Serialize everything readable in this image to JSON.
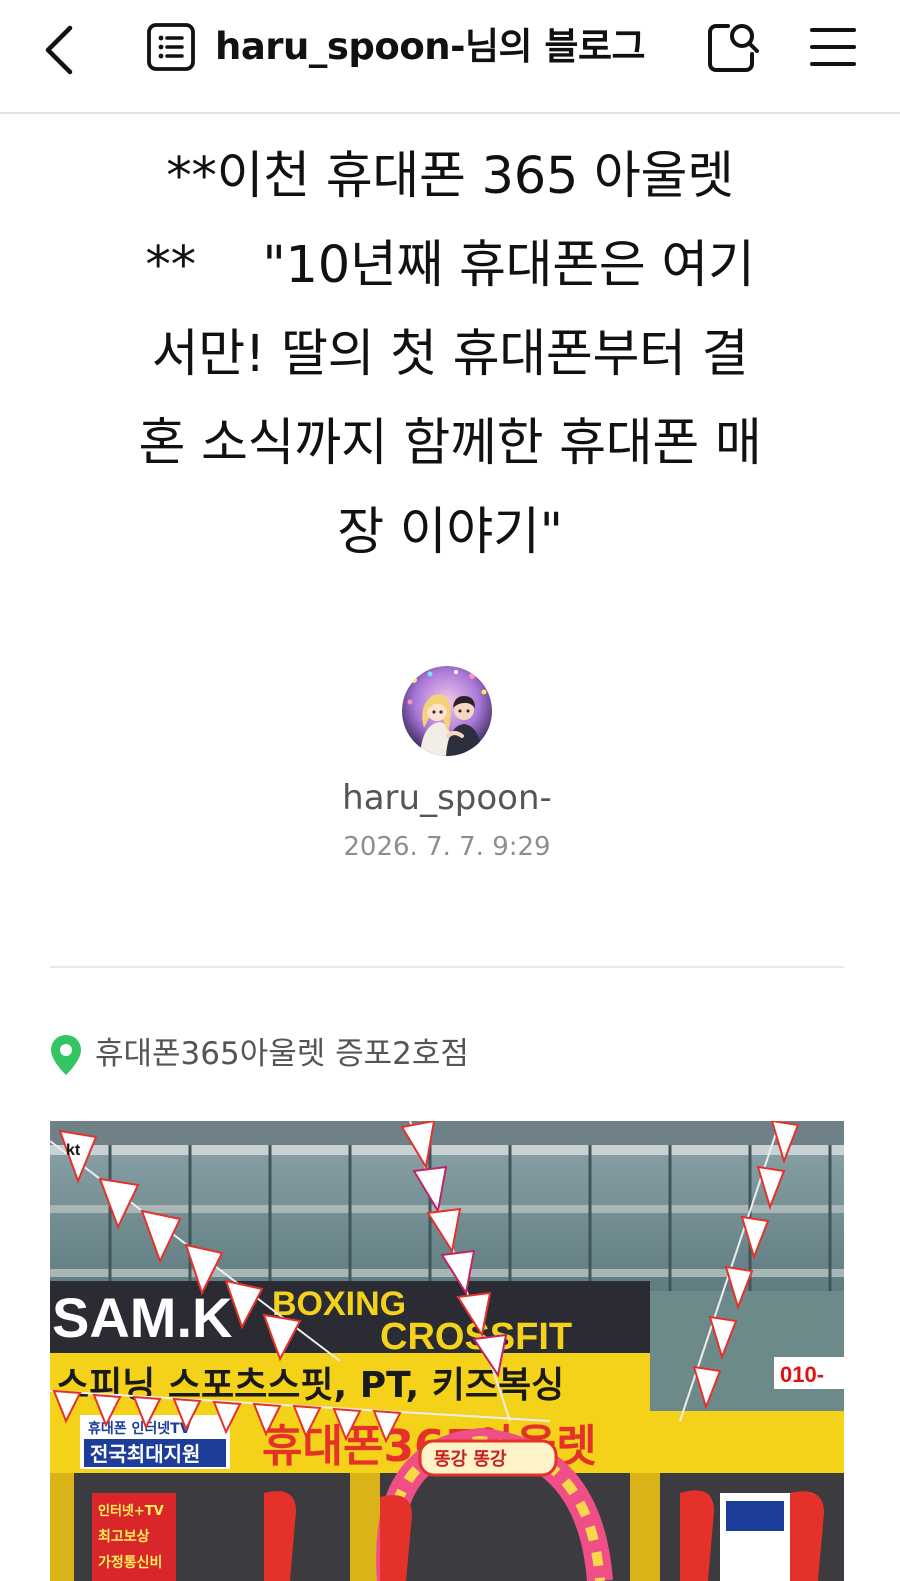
{
  "header": {
    "blog_title": "haru_spoon-님의 블로그"
  },
  "post": {
    "title_lines": [
      "**이천 휴대폰 365 아울렛",
      "**　 \"10년째 휴대폰은 여기",
      "서만! 딸의 첫 휴대폰부터 결",
      "혼 소식까지 함께한 휴대폰 매",
      "장 이야기\""
    ],
    "author": "haru_spoon-",
    "date": "2026. 7. 7. 9:29",
    "location": "휴대폰365아울렛 증포2호점"
  },
  "photo": {
    "sign_gym_line1": "BOXING",
    "sign_gym_line2": "CROSSFIT",
    "sign_gym_brand": "SAM.K",
    "sign_gym_sub": "스피닝 스포츠스핏, PT, 키즈복싱",
    "sign_store": "휴대폰365아울렛",
    "sign_left_small": "휴대폰 인터넷TV",
    "sign_left_big": "전국최대지원",
    "sign_phone": "010-",
    "balloon_text": "똥강 똥강",
    "banner_left": [
      "인터넷+TV",
      "최고보상",
      "가정통신비"
    ],
    "flag_text": "kt"
  },
  "colors": {
    "location_pin": "#33c463",
    "sign_yellow": "#f5d21a",
    "store_sign_red": "#e4322b"
  }
}
